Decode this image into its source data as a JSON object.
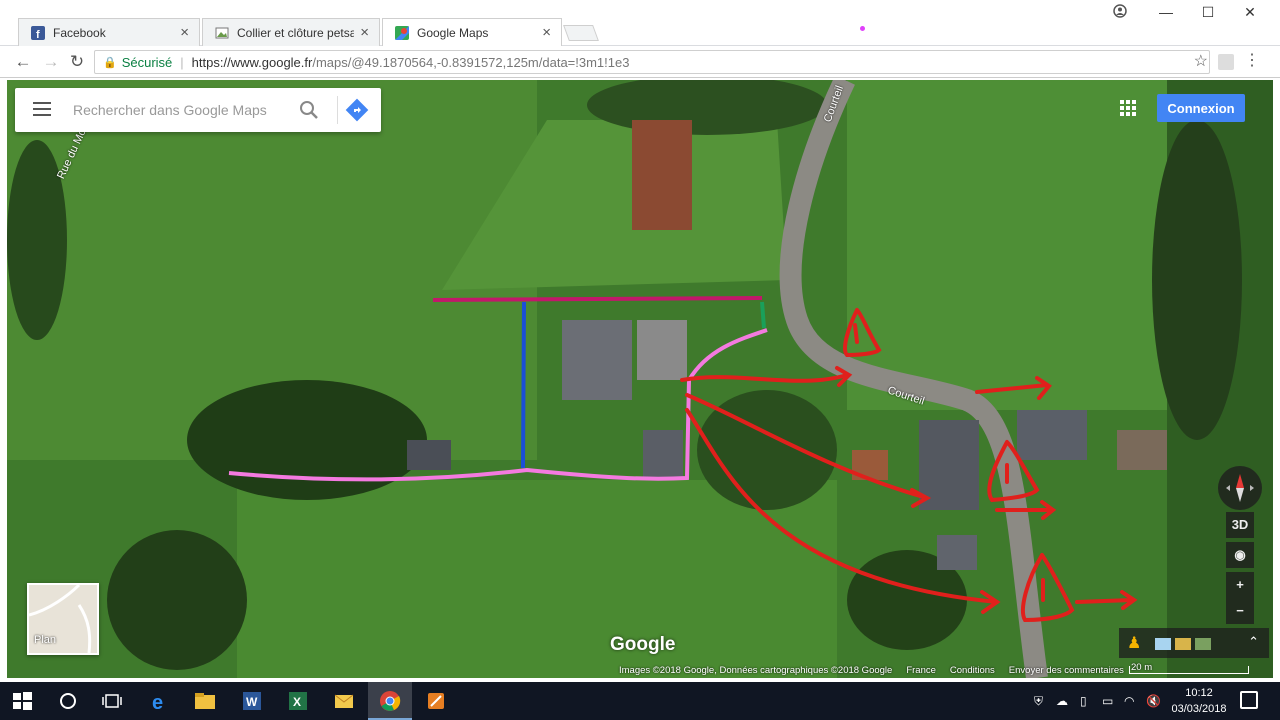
{
  "browser": {
    "tabs": [
      {
        "title": "Facebook",
        "favicon": "facebook-icon",
        "active": false
      },
      {
        "title": "Collier et clôture petsafe",
        "favicon": "picture-icon",
        "active": false
      },
      {
        "title": "Google Maps",
        "favicon": "google-maps-icon",
        "active": true
      }
    ],
    "secure_label": "Sécurisé",
    "url_host": "https://www.google.fr",
    "url_path": "/maps/@49.1870564,-0.8391572,125m/data=!3m1!1e3"
  },
  "maps": {
    "search_placeholder": "Rechercher dans Google Maps",
    "sign_in_label": "Connexion",
    "plan_label": "Plan",
    "logo_text": "Google",
    "tilt_label": "3D",
    "zoom_in": "+",
    "zoom_out": "−",
    "street_labels": [
      "Rue du Mo",
      "Courteil",
      "Courteil"
    ],
    "footer": {
      "imagery": "Images ©2018 Google, Données cartographiques ©2018 Google",
      "country": "France",
      "conditions": "Conditions",
      "feedback": "Envoyer des commentaires",
      "scale": "20 m"
    }
  },
  "taskbar": {
    "time": "10:12",
    "date": "03/03/2018"
  },
  "colors": {
    "accent": "#4285f4",
    "annotation_red": "#e0201c",
    "annotation_pink": "#f47ae0",
    "annotation_magenta": "#c2186a",
    "annotation_blue": "#1a4fd8",
    "annotation_green": "#1aa05a"
  }
}
